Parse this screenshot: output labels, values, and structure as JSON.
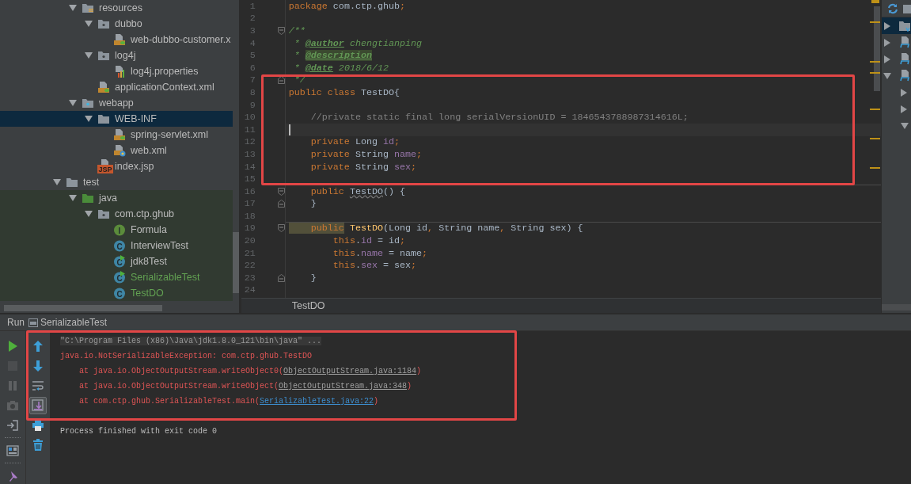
{
  "project_tree": {
    "items": [
      {
        "kind": "offscreen",
        "children": [
          {
            "kind": "resource-root",
            "label": "resources",
            "expanded": true,
            "selected": false,
            "added": false,
            "test_root": false,
            "children": [
              {
                "kind": "package",
                "label": "dubbo",
                "expanded": true,
                "selected": false,
                "added": false,
                "test_root": false,
                "children": [
                  {
                    "kind": "xml-config",
                    "label": "web-dubbo-customer.x",
                    "selected": false,
                    "added": false,
                    "test_root": false
                  }
                ]
              },
              {
                "kind": "package",
                "label": "log4j",
                "expanded": true,
                "selected": false,
                "added": false,
                "test_root": false,
                "children": [
                  {
                    "kind": "properties",
                    "label": "log4j.properties",
                    "selected": false,
                    "added": false,
                    "test_root": false
                  }
                ]
              },
              {
                "kind": "xml-config",
                "label": "applicationContext.xml",
                "selected": false,
                "added": false,
                "test_root": false
              }
            ]
          },
          {
            "kind": "web-folder",
            "label": "webapp",
            "expanded": true,
            "selected": false,
            "added": false,
            "test_root": false,
            "children": [
              {
                "kind": "folder",
                "label": "WEB-INF",
                "expanded": true,
                "selected": true,
                "added": false,
                "test_root": false,
                "children": [
                  {
                    "kind": "xml-config",
                    "label": "spring-servlet.xml",
                    "selected": false,
                    "added": false,
                    "test_root": false
                  },
                  {
                    "kind": "web-xml",
                    "label": "web.xml",
                    "selected": false,
                    "added": false,
                    "test_root": false
                  }
                ]
              },
              {
                "kind": "jsp",
                "icon_text": "JSP",
                "label": "index.jsp",
                "selected": false,
                "added": false,
                "test_root": false
              }
            ]
          }
        ]
      },
      {
        "kind": "folder",
        "label": "test",
        "expanded": true,
        "selected": false,
        "added": false,
        "test_root": false,
        "children": [
          {
            "kind": "source-root",
            "label": "java",
            "expanded": true,
            "selected": false,
            "added": false,
            "test_root": true,
            "children": [
              {
                "kind": "package",
                "label": "com.ctp.ghub",
                "expanded": true,
                "selected": false,
                "added": false,
                "test_root": true,
                "children": [
                  {
                    "kind": "interface",
                    "icon_text": "I",
                    "label": "Formula",
                    "selected": false,
                    "added": false,
                    "test_root": true
                  },
                  {
                    "kind": "class",
                    "icon_text": "C",
                    "label": "InterviewTest",
                    "selected": false,
                    "added": false,
                    "test_root": true
                  },
                  {
                    "kind": "class-main",
                    "icon_text": "C",
                    "label": "jdk8Test",
                    "selected": false,
                    "added": false,
                    "test_root": true
                  },
                  {
                    "kind": "class-main",
                    "icon_text": "C",
                    "label": "SerializableTest",
                    "selected": false,
                    "added": true,
                    "test_root": true
                  },
                  {
                    "kind": "class",
                    "icon_text": "C",
                    "label": "TestDO",
                    "selected": false,
                    "added": true,
                    "test_root": true
                  }
                ]
              }
            ]
          }
        ]
      }
    ]
  },
  "editor": {
    "highlight_box": true,
    "lines": [
      {
        "number": "1",
        "tokens": [
          {
            "text": "package",
            "kind": "keyword"
          },
          {
            "text": " com.ctp.ghub",
            "kind": "plain"
          },
          {
            "text": ";",
            "kind": "keyword"
          }
        ]
      },
      {
        "number": "2"
      },
      {
        "number": "3",
        "fold_start": true,
        "tokens": [
          {
            "text": "/**",
            "kind": "doc"
          }
        ]
      },
      {
        "number": "4",
        "tokens": [
          {
            "text": " * ",
            "kind": "doc"
          },
          {
            "text": "@author",
            "kind": "doc-tag"
          },
          {
            "text": " chengtianping",
            "kind": "doc"
          }
        ]
      },
      {
        "number": "5",
        "tokens": [
          {
            "text": " * ",
            "kind": "doc"
          },
          {
            "text": "@description",
            "kind": "doc-tag-highlight"
          }
        ]
      },
      {
        "number": "6",
        "tokens": [
          {
            "text": " * ",
            "kind": "doc"
          },
          {
            "text": "@date",
            "kind": "doc-tag"
          },
          {
            "text": " 2018/6/12",
            "kind": "doc"
          }
        ]
      },
      {
        "number": "7",
        "fold_end": true,
        "tokens": [
          {
            "text": " */",
            "kind": "doc"
          }
        ]
      },
      {
        "number": "8",
        "tokens": [
          {
            "text": "public class ",
            "kind": "keyword"
          },
          {
            "text": "TestDO{",
            "kind": "plain"
          }
        ]
      },
      {
        "number": "9"
      },
      {
        "number": "10",
        "tokens": [
          {
            "text": "    //private static final long serialVersionUID = 1846543788987314616L;",
            "kind": "comment"
          }
        ]
      },
      {
        "number": "11",
        "current": true
      },
      {
        "number": "12",
        "tokens": [
          {
            "text": "    private ",
            "kind": "keyword"
          },
          {
            "text": "Long ",
            "kind": "plain"
          },
          {
            "text": "id",
            "kind": "field"
          },
          {
            "text": ";",
            "kind": "keyword"
          }
        ]
      },
      {
        "number": "13",
        "tokens": [
          {
            "text": "    private ",
            "kind": "keyword"
          },
          {
            "text": "String ",
            "kind": "plain"
          },
          {
            "text": "name",
            "kind": "field"
          },
          {
            "text": ";",
            "kind": "keyword"
          }
        ]
      },
      {
        "number": "14",
        "tokens": [
          {
            "text": "    private ",
            "kind": "keyword"
          },
          {
            "text": "String ",
            "kind": "plain"
          },
          {
            "text": "sex",
            "kind": "field"
          },
          {
            "text": ";",
            "kind": "keyword"
          }
        ]
      },
      {
        "number": "15",
        "separator_below": true
      },
      {
        "number": "16",
        "fold_start": true,
        "tokens": [
          {
            "text": "    public ",
            "kind": "keyword"
          },
          {
            "text": "TestDO",
            "kind": "warning"
          },
          {
            "text": "() {",
            "kind": "plain"
          }
        ]
      },
      {
        "number": "17",
        "fold_end": true,
        "tokens": [
          {
            "text": "    }",
            "kind": "plain"
          }
        ]
      },
      {
        "number": "18",
        "separator_below": true
      },
      {
        "number": "19",
        "fold_start": true,
        "tokens": [
          {
            "text": "    public",
            "kind": "keyword-highlight"
          },
          {
            "text": " TestDO",
            "kind": "method"
          },
          {
            "text": "(Long id",
            "kind": "plain"
          },
          {
            "text": ", ",
            "kind": "keyword"
          },
          {
            "text": "String name",
            "kind": "plain"
          },
          {
            "text": ", ",
            "kind": "keyword"
          },
          {
            "text": "String sex) {",
            "kind": "plain"
          }
        ]
      },
      {
        "number": "20",
        "tokens": [
          {
            "text": "        this",
            "kind": "keyword"
          },
          {
            "text": ".",
            "kind": "plain"
          },
          {
            "text": "id",
            "kind": "field"
          },
          {
            "text": " = id",
            "kind": "plain"
          },
          {
            "text": ";",
            "kind": "keyword"
          }
        ]
      },
      {
        "number": "21",
        "tokens": [
          {
            "text": "        this",
            "kind": "keyword"
          },
          {
            "text": ".",
            "kind": "plain"
          },
          {
            "text": "name",
            "kind": "field"
          },
          {
            "text": " = name",
            "kind": "plain"
          },
          {
            "text": ";",
            "kind": "keyword"
          }
        ]
      },
      {
        "number": "22",
        "tokens": [
          {
            "text": "        this",
            "kind": "keyword"
          },
          {
            "text": ".",
            "kind": "plain"
          },
          {
            "text": "sex",
            "kind": "field"
          },
          {
            "text": " = sex",
            "kind": "plain"
          },
          {
            "text": ";",
            "kind": "keyword"
          }
        ]
      },
      {
        "number": "23",
        "fold_end": true,
        "tokens": [
          {
            "text": "    }",
            "kind": "plain"
          }
        ]
      },
      {
        "number": "24"
      }
    ],
    "breadcrumb": "TestDO"
  },
  "side_panel": {
    "items": [
      {
        "kind": "module-folder",
        "expanded": false,
        "selected": true
      },
      {
        "kind": "module",
        "expanded": false,
        "selected": false
      },
      {
        "kind": "module",
        "expanded": false,
        "selected": false
      },
      {
        "kind": "module",
        "expanded": true,
        "selected": false,
        "children": [
          {
            "expanded": false,
            "selected": false
          },
          {
            "expanded": false,
            "selected": false
          },
          {
            "expanded": true,
            "selected": false
          }
        ]
      }
    ]
  },
  "run_panel": {
    "label": "Run",
    "tab": "SerializableTest",
    "highlight_box": true,
    "left_tools": [
      {
        "kind": "run",
        "disabled": false
      },
      {
        "kind": "stop",
        "disabled": true
      },
      {
        "kind": "pause",
        "disabled": true
      },
      {
        "kind": "camera",
        "disabled": true
      },
      {
        "kind": "exit",
        "disabled": false
      },
      {
        "kind": "separator"
      },
      {
        "kind": "layout",
        "disabled": false
      },
      {
        "kind": "separator"
      },
      {
        "kind": "pin",
        "disabled": false
      }
    ],
    "console_tools": [
      {
        "kind": "up",
        "on": false
      },
      {
        "kind": "down",
        "on": false
      },
      {
        "kind": "wrap",
        "on": false
      },
      {
        "kind": "scroll-end",
        "on": true
      },
      {
        "kind": "print",
        "on": false
      },
      {
        "kind": "trash",
        "on": false
      }
    ],
    "console": [
      {
        "kind": "command",
        "parts": [
          {
            "text": "\"C:\\Program Files (x86)\\Java\\jdk1.8.0_121\\bin\\java\" ...",
            "kind": "command"
          }
        ]
      },
      {
        "kind": "output",
        "parts": [
          {
            "text": "java.io.NotSerializableException: com.ctp.ghub.TestDO",
            "kind": "error"
          }
        ]
      },
      {
        "kind": "output",
        "parts": [
          {
            "text": "    at java.io.ObjectOutputStream.writeObject0(",
            "kind": "error"
          },
          {
            "text": "ObjectOutputStream.java:1184",
            "kind": "link-muted"
          },
          {
            "text": ")",
            "kind": "error"
          }
        ]
      },
      {
        "kind": "output",
        "parts": [
          {
            "text": "    at java.io.ObjectOutputStream.writeObject(",
            "kind": "error"
          },
          {
            "text": "ObjectOutputStream.java:348",
            "kind": "link-muted"
          },
          {
            "text": ")",
            "kind": "error"
          }
        ]
      },
      {
        "kind": "output",
        "parts": [
          {
            "text": "    at com.ctp.ghub.SerializableTest.main(",
            "kind": "error"
          },
          {
            "text": "SerializableTest.java:22",
            "kind": "link"
          },
          {
            "text": ")",
            "kind": "error"
          }
        ]
      },
      {
        "kind": "blank"
      },
      {
        "kind": "output",
        "parts": [
          {
            "text": "Process finished with exit code 0",
            "kind": "plain"
          }
        ]
      }
    ]
  }
}
